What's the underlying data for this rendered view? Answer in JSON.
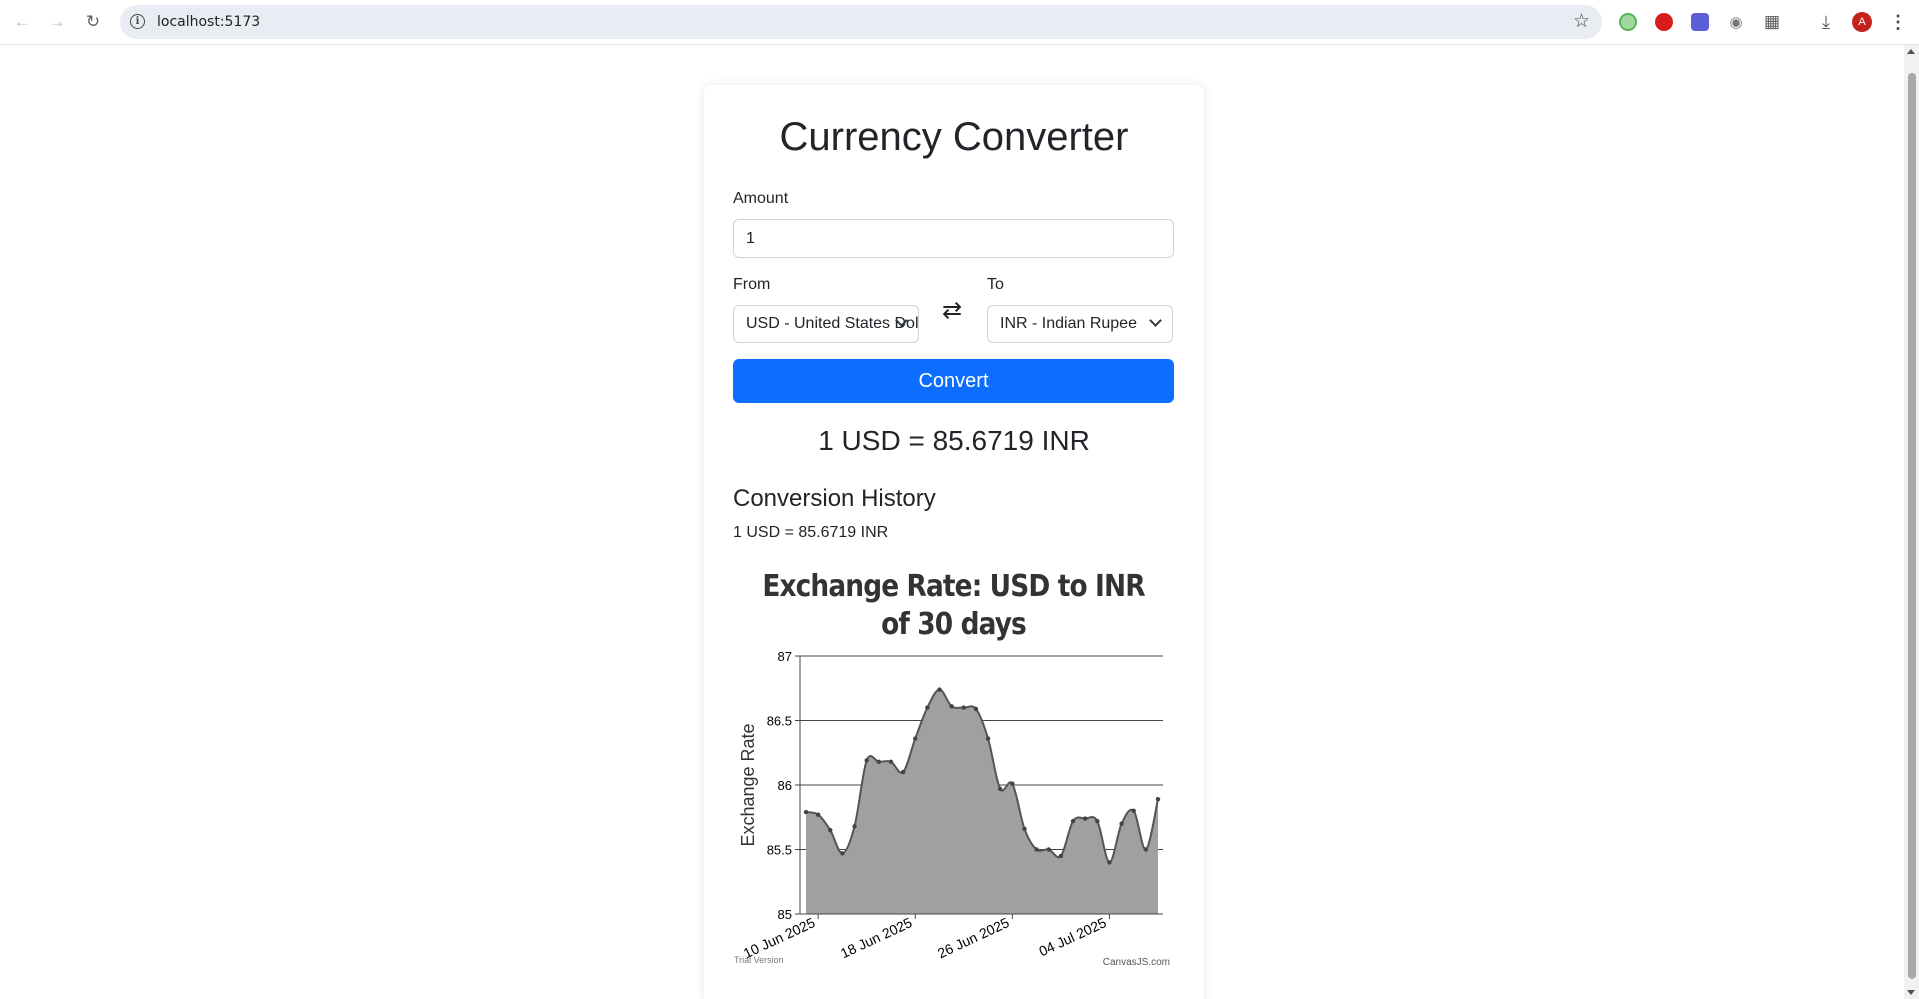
{
  "browser": {
    "url": "localhost:5173",
    "icons": [
      "back-icon",
      "forward-icon",
      "reload-icon",
      "site-info-icon",
      "bookmark-star-icon",
      "extension-icon",
      "download-icon",
      "profile-avatar",
      "menu-icon"
    ],
    "avatar_letter": "A"
  },
  "app": {
    "title": "Currency Converter",
    "amount_label": "Amount",
    "amount_value": "1",
    "from_label": "From",
    "from_value": "USD - United States Dollar",
    "to_label": "To",
    "to_value": "INR - Indian Rupee",
    "swap_icon": "⇄",
    "convert_label": "Convert",
    "result": "1 USD = 85.6719 INR",
    "history_title": "Conversion History",
    "history": [
      "1 USD = 85.6719 INR"
    ],
    "accent_color": "#0d6efd"
  },
  "chart_data": {
    "type": "area",
    "title": "Exchange Rate: USD to INR of 30 days",
    "ylabel": "Exchange Rate",
    "xlabel": "",
    "ylim": [
      85,
      87
    ],
    "yticks": [
      "85",
      "85.5",
      "86",
      "86.5",
      "87"
    ],
    "xticks": [
      "10 Jun 2025",
      "18 Jun 2025",
      "26 Jun 2025",
      "04 Jul 2025"
    ],
    "grid": true,
    "fill_color": "#a0a0a0",
    "line_color": "#555555",
    "watermark_left": "Trial Version",
    "watermark_right": "CanvasJS.com",
    "series": [
      {
        "x": [
          "2025-06-09",
          "2025-06-10",
          "2025-06-11",
          "2025-06-12",
          "2025-06-13",
          "2025-06-14",
          "2025-06-15",
          "2025-06-16",
          "2025-06-17",
          "2025-06-18",
          "2025-06-19",
          "2025-06-20",
          "2025-06-21",
          "2025-06-22",
          "2025-06-23",
          "2025-06-24",
          "2025-06-25",
          "2025-06-26",
          "2025-06-27",
          "2025-06-28",
          "2025-06-29",
          "2025-06-30",
          "2025-07-01",
          "2025-07-02",
          "2025-07-03",
          "2025-07-04",
          "2025-07-05",
          "2025-07-06",
          "2025-07-07",
          "2025-07-08"
        ],
        "values": [
          85.79,
          85.77,
          85.65,
          85.47,
          85.68,
          86.19,
          86.18,
          86.18,
          86.1,
          86.36,
          86.6,
          86.74,
          86.61,
          86.6,
          86.59,
          86.36,
          85.97,
          86.01,
          85.66,
          85.5,
          85.5,
          85.45,
          85.72,
          85.74,
          85.72,
          85.4,
          85.7,
          85.8,
          85.5,
          85.89
        ]
      }
    ]
  }
}
